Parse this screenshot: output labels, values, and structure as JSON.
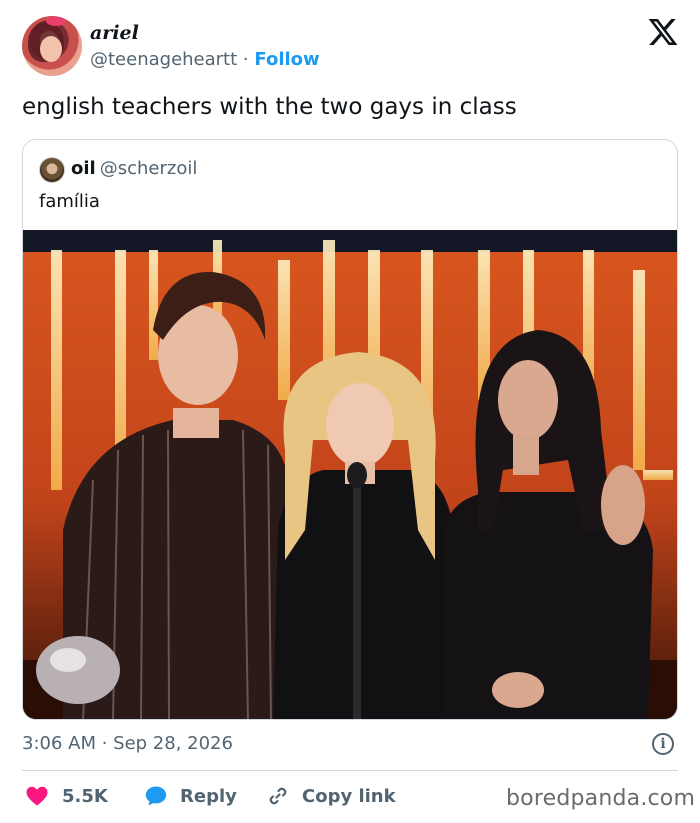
{
  "author": {
    "display_name": "ariel",
    "handle": "@teenageheartt",
    "separator": "·",
    "follow_label": "Follow"
  },
  "tweet": {
    "text": "english teachers with the two gays in class",
    "timestamp": "3:06 AM · Sep 28, 2026"
  },
  "quote": {
    "name": "oil",
    "handle": "@scherzoil",
    "text": "família"
  },
  "actions": {
    "like_count": "5.5K",
    "reply_label": "Reply",
    "copy_label": "Copy link"
  },
  "icons": {
    "brand": "x-logo-icon",
    "like": "heart-icon",
    "reply": "speech-bubble-icon",
    "copy": "link-icon",
    "info": "info-icon"
  },
  "colors": {
    "accent": "#1d9bf0",
    "like": "#f91880",
    "text": "#0f1419",
    "muted": "#536471"
  },
  "watermark": "boredpanda.com"
}
